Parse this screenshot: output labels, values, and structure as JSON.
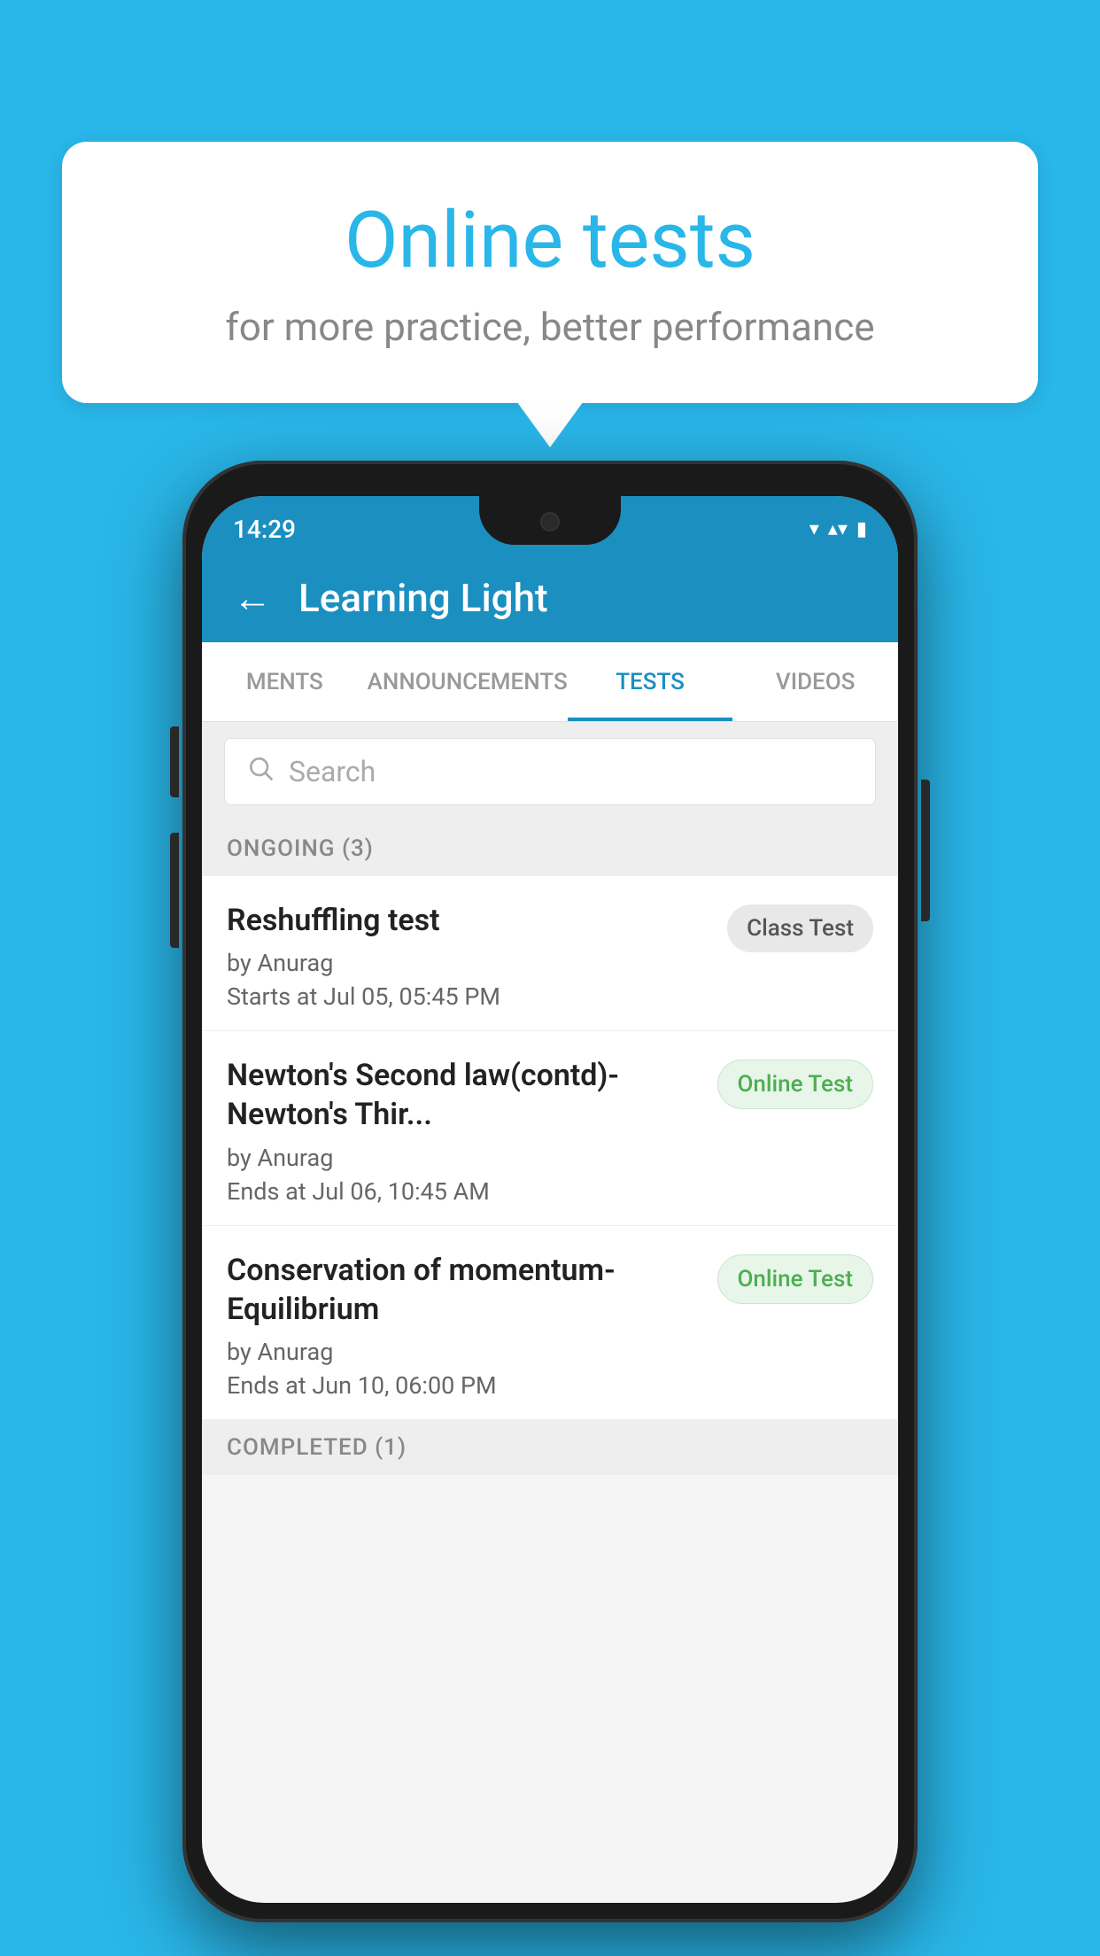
{
  "background_color": "#29b6e8",
  "speech_bubble": {
    "title": "Online tests",
    "subtitle": "for more practice, better performance"
  },
  "phone": {
    "status_bar": {
      "time": "14:29",
      "icons": [
        "▾",
        "▴▾",
        "▮"
      ]
    },
    "app_bar": {
      "back_label": "←",
      "title": "Learning Light"
    },
    "tabs": [
      {
        "label": "MENTS",
        "active": false
      },
      {
        "label": "ANNOUNCEMENTS",
        "active": false
      },
      {
        "label": "TESTS",
        "active": true
      },
      {
        "label": "VIDEOS",
        "active": false
      }
    ],
    "search": {
      "placeholder": "Search"
    },
    "sections": [
      {
        "header": "ONGOING (3)",
        "tests": [
          {
            "name": "Reshuffling test",
            "author": "by Anurag",
            "date": "Starts at  Jul 05, 05:45 PM",
            "badge": "Class Test",
            "badge_type": "class"
          },
          {
            "name": "Newton's Second law(contd)-Newton's Thir...",
            "author": "by Anurag",
            "date": "Ends at  Jul 06, 10:45 AM",
            "badge": "Online Test",
            "badge_type": "online"
          },
          {
            "name": "Conservation of momentum-Equilibrium",
            "author": "by Anurag",
            "date": "Ends at  Jun 10, 06:00 PM",
            "badge": "Online Test",
            "badge_type": "online"
          }
        ]
      }
    ],
    "completed_section_label": "COMPLETED (1)"
  }
}
